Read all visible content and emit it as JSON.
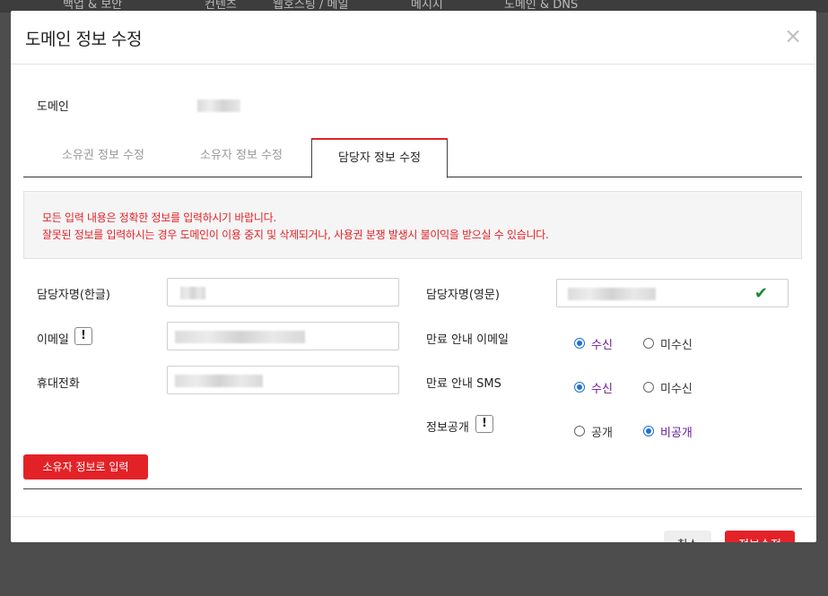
{
  "background_nav": [
    "백업 & 보안",
    "컨텐츠",
    "웹호스팅 / 메일",
    "메시지",
    "도메인 & DNS"
  ],
  "modal": {
    "title": "도메인 정보 수정",
    "close_icon": "close-icon",
    "domain_label": "도메인",
    "tabs": [
      "소유권 정보 수정",
      "소유자 정보 수정",
      "담당자 정보 수정"
    ],
    "active_tab": 2,
    "notice": [
      "모든 입력 내용은 정확한 정보를 입력하시기 바랍니다.",
      "잘못된 정보를 입력하시는 경우 도메인이 이용 중지 및 삭제되거나, 사용권 분쟁 발생시 불이익을 받으실 수 있습니다."
    ],
    "fields": {
      "name_kr_label": "담당자명(한글)",
      "name_en_label": "담당자명(영문)",
      "email_label": "이메일",
      "phone_label": "휴대전화",
      "expiry_email_label": "만료 안내 이메일",
      "expiry_sms_label": "만료 안내 SMS",
      "disclosure_label": "정보공개",
      "warn_icon": "!",
      "check_icon": "✔"
    },
    "radios": {
      "expiry_email": {
        "yes": "수신",
        "no": "미수신",
        "selected": "yes"
      },
      "expiry_sms": {
        "yes": "수신",
        "no": "미수신",
        "selected": "yes"
      },
      "disclosure": {
        "public": "공개",
        "private": "비공개",
        "selected": "private"
      }
    },
    "owner_copy_button": "소유자 정보로 입력",
    "cancel_button": "취소",
    "submit_button": "정보수정"
  },
  "colors": {
    "accent": "#e32228",
    "radio": "#1e6fd9",
    "check": "#1c8a3a"
  }
}
